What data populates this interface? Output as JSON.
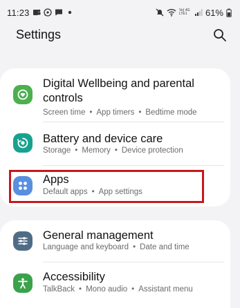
{
  "status_bar": {
    "time": "11:23",
    "network_label": "Vo) 4G LTE1",
    "battery": "61%"
  },
  "header": {
    "title": "Settings"
  },
  "colors": {
    "wellbeing": "#4caf50",
    "battery": "#17a28f",
    "apps": "#5a8fe0",
    "general": "#4f6c87",
    "accessibility": "#3aa24b",
    "highlight": "#c8161d"
  },
  "settings": {
    "wellbeing": {
      "title": "Digital Wellbeing and parental controls",
      "sub": [
        "Screen time",
        "App timers",
        "Bedtime mode"
      ],
      "icon": "heart-icon"
    },
    "battery": {
      "title": "Battery and device care",
      "sub": [
        "Storage",
        "Memory",
        "Device protection"
      ],
      "icon": "device-care-icon"
    },
    "apps": {
      "title": "Apps",
      "sub": [
        "Default apps",
        "App settings"
      ],
      "icon": "apps-icon"
    },
    "general": {
      "title": "General management",
      "sub": [
        "Language and keyboard",
        "Date and time"
      ],
      "icon": "sliders-icon"
    },
    "accessibility": {
      "title": "Accessibility",
      "sub": [
        "TalkBack",
        "Mono audio",
        "Assistant menu"
      ],
      "icon": "accessibility-icon"
    }
  },
  "separator": "•"
}
